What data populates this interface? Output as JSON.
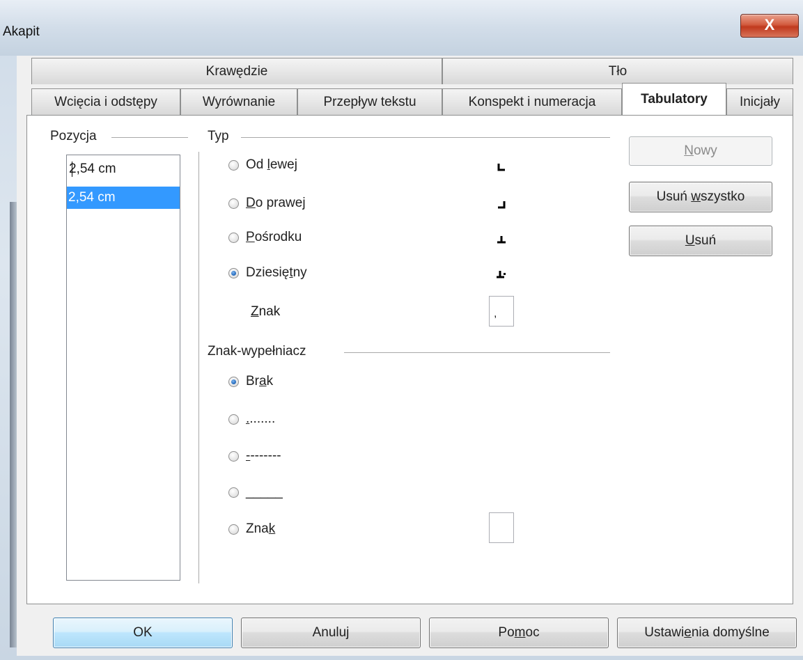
{
  "window": {
    "title": "Akapit",
    "close_label": "X"
  },
  "tabs": {
    "row1": [
      {
        "label": "Krawędzie"
      },
      {
        "label": "Tło"
      }
    ],
    "row2": [
      {
        "label": "Wcięcia i odstępy"
      },
      {
        "label": "Wyrównanie"
      },
      {
        "label": "Przepływ tekstu"
      },
      {
        "label": "Konspekt i numeracja"
      },
      {
        "label": "Tabulatory",
        "active": true
      },
      {
        "label": "Inicjały"
      }
    ]
  },
  "position": {
    "header": "Pozycja",
    "input_value": "2,54 cm",
    "list": [
      "2,54 cm"
    ],
    "selected_index": 0
  },
  "type": {
    "header": "Typ",
    "options": [
      {
        "pre": "Od ",
        "mn": "l",
        "post": "ewej",
        "checked": false,
        "icon": "tab-left-icon"
      },
      {
        "pre": "",
        "mn": "D",
        "post": "o prawej",
        "checked": false,
        "icon": "tab-right-icon"
      },
      {
        "pre": "",
        "mn": "P",
        "post": "ośrodku",
        "checked": false,
        "icon": "tab-center-icon"
      },
      {
        "pre": "Dziesię",
        "mn": "t",
        "post": "ny",
        "checked": true,
        "icon": "tab-decimal-icon"
      }
    ],
    "char_label_mn": "Z",
    "char_label_rest": "nak",
    "char_value": ","
  },
  "fill": {
    "header": "Znak-wypełniacz",
    "options": [
      {
        "pre": "Br",
        "mn": "a",
        "post": "k",
        "checked": true
      },
      {
        "pre": "",
        "mn": ".",
        "post": ".......",
        "checked": false
      },
      {
        "pre": "",
        "mn": "-",
        "post": "-------",
        "checked": false
      },
      {
        "pre": "",
        "mn": "_",
        "post": "____",
        "checked": false
      },
      {
        "pre": "Zna",
        "mn": "k",
        "post": "",
        "checked": false
      }
    ],
    "char_value": ""
  },
  "actions": {
    "new_mn": "N",
    "new_rest": "owy",
    "new_enabled": false,
    "delete_all_pre": "Usuń ",
    "delete_all_mn": "w",
    "delete_all_post": "szystko",
    "delete_mn": "U",
    "delete_rest": "suń"
  },
  "footer": {
    "ok": "OK",
    "cancel": "Anuluj",
    "help_pre": "Po",
    "help_mn": "m",
    "help_post": "oc",
    "defaults_pre": "Ustawi",
    "defaults_mn": "e",
    "defaults_post": "nia domyślne"
  }
}
